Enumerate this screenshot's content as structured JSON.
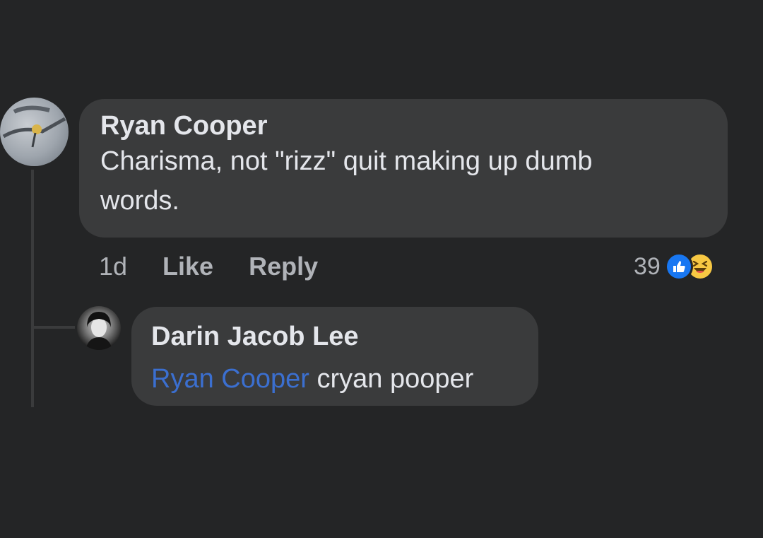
{
  "comment": {
    "author": "Ryan Cooper",
    "text_line1": "Charisma, not \"rizz\" quit making up dumb",
    "text_line2": "words.",
    "time": "1d",
    "like_label": "Like",
    "reply_label": "Reply",
    "reaction_count": "39",
    "reactions": [
      "like-icon",
      "haha-icon"
    ]
  },
  "reply": {
    "author": "Darin Jacob Lee",
    "mention": "Ryan Cooper",
    "text": " cryan pooper"
  },
  "colors": {
    "background": "#242526",
    "bubble": "#3a3b3c",
    "text": "#e4e6eb",
    "muted": "#b0b3b8",
    "mention": "#3b6fd0",
    "like": "#1877f2",
    "haha": "#f7c843"
  }
}
